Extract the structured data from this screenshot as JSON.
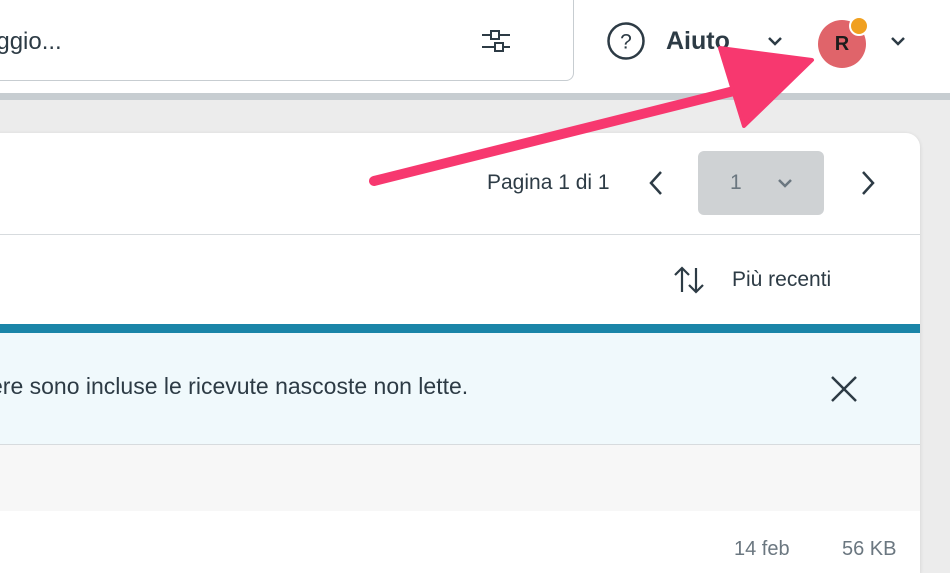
{
  "header": {
    "search": {
      "value": "",
      "placeholder": "aggio..."
    },
    "filter_icon": "sliders-icon",
    "help": {
      "icon": "question-circle-icon",
      "label": "Aiuto"
    },
    "user": {
      "initial": "R",
      "avatar_color": "#e0646a",
      "notification_color": "#f0a020"
    }
  },
  "pagination": {
    "page_info": "Pagina 1 di 1",
    "current_page": "1"
  },
  "sort": {
    "label": "Più recenti",
    "icon": "sort-arrows-icon"
  },
  "banner": {
    "text": "ere sono incluse le ricevute nascoste non lette.",
    "accent_color": "#1a85a8"
  },
  "items": [
    {
      "date": "14 feb",
      "size": "56 KB"
    }
  ],
  "annotation": {
    "color": "#f7386f"
  }
}
